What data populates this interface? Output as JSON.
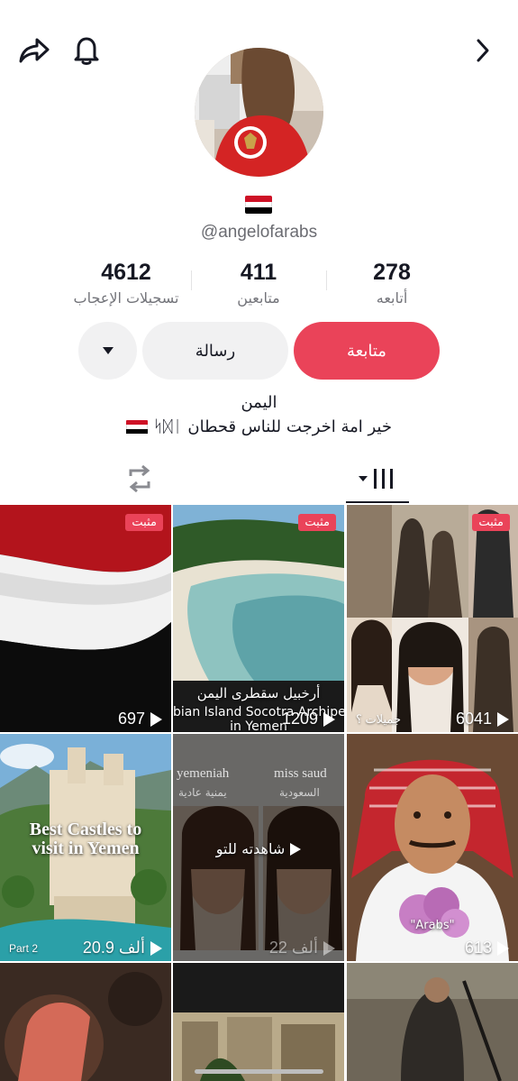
{
  "profile": {
    "username": "@angelofarabs",
    "flag_colors": [
      "#ce1126",
      "#ffffff",
      "#000000"
    ]
  },
  "stats": {
    "likes": {
      "value": "4612",
      "label": "تسجيلات الإعجاب"
    },
    "followers": {
      "value": "411",
      "label": "متابعين"
    },
    "following": {
      "value": "278",
      "label": "أتابعه"
    }
  },
  "buttons": {
    "follow_label": "متابعة",
    "message_label": "رسالة",
    "follow_color": "#ea4359"
  },
  "bio": {
    "line1": "اليمن",
    "line2": "خير امة اخرجت للناس قحطان",
    "line2_glyphs": "ᛋᛞᛁ"
  },
  "icons": {
    "share": "share-icon",
    "bell": "bell-icon",
    "next": "chevron-right-icon",
    "repost": "repost-icon",
    "videos": "videos-grid-icon",
    "more": "chevron-down-icon"
  },
  "videos": [
    {
      "views": "697",
      "pinned": true,
      "pin_label": "مثبت"
    },
    {
      "views": "1209",
      "pinned": true,
      "pin_label": "مثبت",
      "caption_ar": "أرخبيل سقطرى اليمن",
      "caption_en1": "bian Island Socotra Archipel",
      "caption_en2": "in Yemen"
    },
    {
      "views": "6041",
      "pinned": true,
      "pin_label": "مثبت",
      "caption_ar": "جميلات ؟"
    },
    {
      "views": "20.9 ألف",
      "pinned": false,
      "title": "Best Castles to visit in Yemen",
      "part": "Part 2"
    },
    {
      "views": "22 ألف",
      "pinned": false,
      "overlay": "شاهدته للتو",
      "top_left": "yemeniah",
      "top_right": "miss saud",
      "sub_left": "يمنية عادية",
      "sub_right": "السعودية"
    },
    {
      "views": "613",
      "pinned": false,
      "caption_en": "\"Arabs\""
    },
    {
      "views": "",
      "pinned": false
    },
    {
      "views": "",
      "pinned": false
    },
    {
      "views": "",
      "pinned": false
    }
  ]
}
